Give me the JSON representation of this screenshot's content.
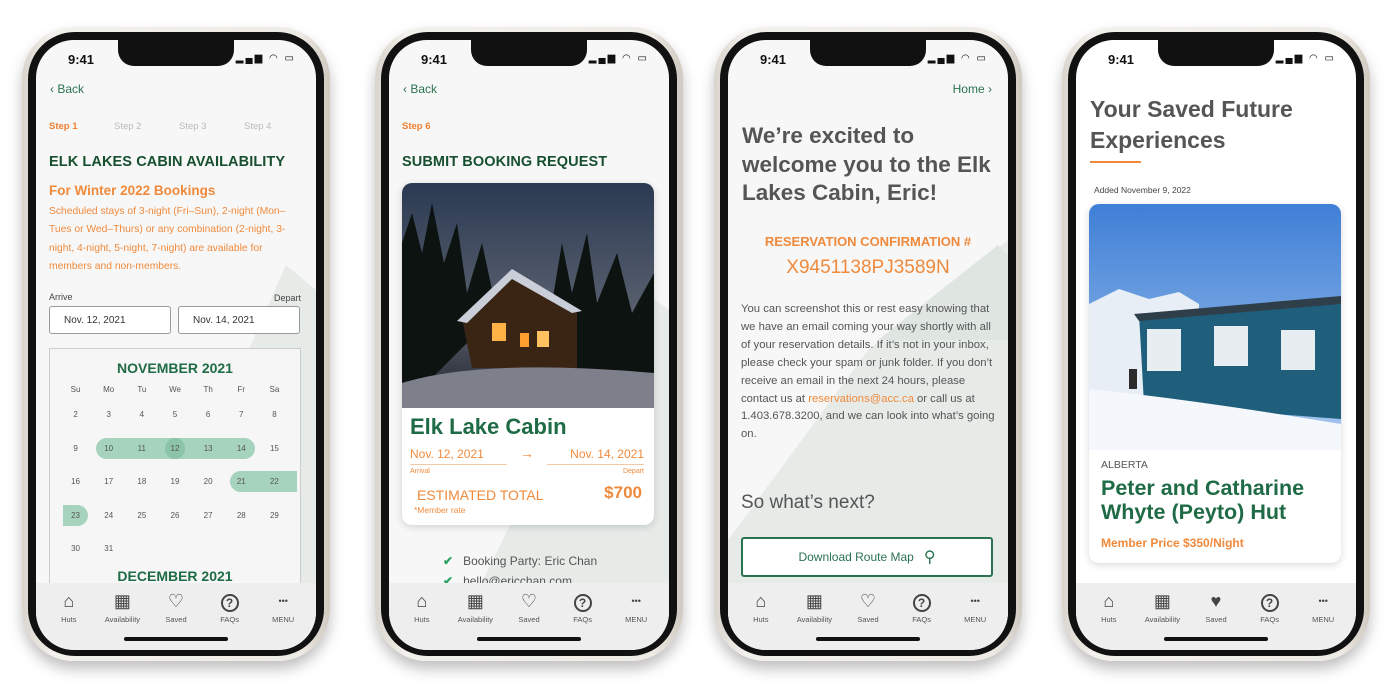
{
  "status": {
    "time": "9:41"
  },
  "nav": [
    {
      "label": "Huts",
      "icon": "home-icon"
    },
    {
      "label": "Availability",
      "icon": "calendar-icon"
    },
    {
      "label": "Saved",
      "icon": "heart-icon"
    },
    {
      "label": "FAQs",
      "icon": "question-icon"
    },
    {
      "label": "MENU",
      "icon": "more-icon"
    }
  ],
  "screen1": {
    "back": "Back",
    "steps": [
      "Step 1",
      "Step 2",
      "Step 3",
      "Step 4"
    ],
    "title": "ELK LAKES CABIN AVAILABILITY",
    "subtitle": "For Winter 2022 Bookings",
    "description": "Scheduled stays of 3-night (Fri–Sun), 2-night (Mon–Tues or Wed–Thurs) or any combination (2-night, 3-night, 4-night, 5-night, 7-night) are available for members and non-members.",
    "arrive_label": "Arrive",
    "depart_label": "Depart",
    "arrive_value": "Nov. 12, 2021",
    "depart_value": "Nov. 14, 2021",
    "calendar": {
      "month": "NOVEMBER 2021",
      "next_month": "DECEMBER 2021",
      "weekdays": [
        "Su",
        "Mo",
        "Tu",
        "We",
        "Th",
        "Fr",
        "Sa"
      ],
      "rows": [
        [
          "2",
          "3",
          "4",
          "5",
          "6",
          "7",
          "8"
        ],
        [
          "9",
          "10",
          "11",
          "12",
          "13",
          "14",
          "15"
        ],
        [
          "16",
          "17",
          "18",
          "19",
          "20",
          "21",
          "22"
        ],
        [
          "23",
          "24",
          "25",
          "26",
          "27",
          "28",
          "29"
        ],
        [
          "30",
          "31",
          "",
          "",
          "",
          "",
          ""
        ]
      ],
      "available": [
        "10",
        "11",
        "12",
        "13",
        "14",
        "21",
        "22",
        "23"
      ],
      "selected": "12"
    }
  },
  "screen2": {
    "back": "Back",
    "step": "Step 6",
    "title": "SUBMIT BOOKING REQUEST",
    "cabin": "Elk Lake Cabin",
    "arrival_date": "Nov. 12, 2021",
    "depart_date": "Nov. 14, 2021",
    "arrival_label": "Arrival",
    "depart_label": "Depart",
    "total_label": "ESTIMATED TOTAL",
    "total": "$700",
    "rate_note": "*Member rate",
    "checklist": [
      "Booking Party: Eric Chan",
      "hello@ericchan.com"
    ]
  },
  "screen3": {
    "home": "Home",
    "heading": "We’re excited to welcome you to the Elk Lakes Cabin, Eric!",
    "conf_label": "RESERVATION CONFIRMATION #",
    "conf_code": "X9451138PJ3589N",
    "para_1": "You can screenshot this or rest easy knowing that we have an email coming your way shortly with all of your reservation details. If it’s not in your inbox, please check your spam or junk folder. If you don’t receive an email in the next 24 hours, please contact us at ",
    "email": "reservations@acc.ca",
    "para_2": " or call us at 1.403.678.3200, and we can look into what’s going on.",
    "next": "So what’s next?",
    "button": "Download Route Map"
  },
  "screen4": {
    "title": "Your Saved Future Experiences",
    "added": "Added November 9, 2022",
    "region": "ALBERTA",
    "hut": "Peter and Catharine Whyte (Peyto) Hut",
    "price": "Member Price $350/Night"
  },
  "colors": {
    "green": "#1e6b45",
    "dark_green": "#164d30",
    "orange": "#ef8a3c",
    "highlight": "#a6d3bd"
  }
}
